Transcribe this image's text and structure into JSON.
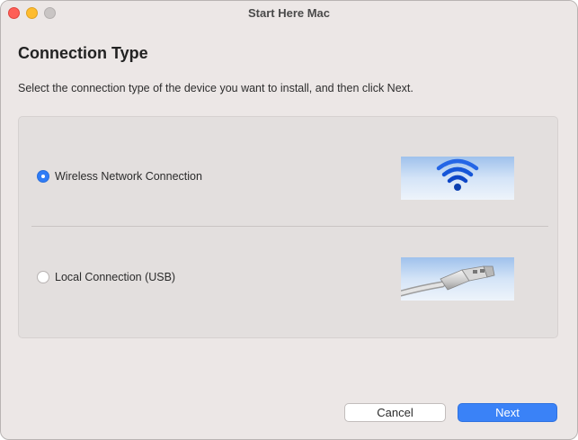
{
  "window": {
    "title": "Start Here Mac"
  },
  "page": {
    "heading": "Connection Type",
    "instructions": "Select the connection type of the device you want to install, and then click Next."
  },
  "options": [
    {
      "label": "Wireless Network Connection",
      "selected": true,
      "icon": "wifi-icon"
    },
    {
      "label": "Local Connection (USB)",
      "selected": false,
      "icon": "usb-cable-icon"
    }
  ],
  "buttons": {
    "cancel": "Cancel",
    "next": "Next"
  },
  "colors": {
    "accent": "#3a82f7",
    "window_bg": "#ece7e6",
    "panel_bg": "#e3dfde",
    "close": "#fe5f57",
    "minimize": "#febc2e",
    "maximize_inactive": "#c9c5c4"
  }
}
